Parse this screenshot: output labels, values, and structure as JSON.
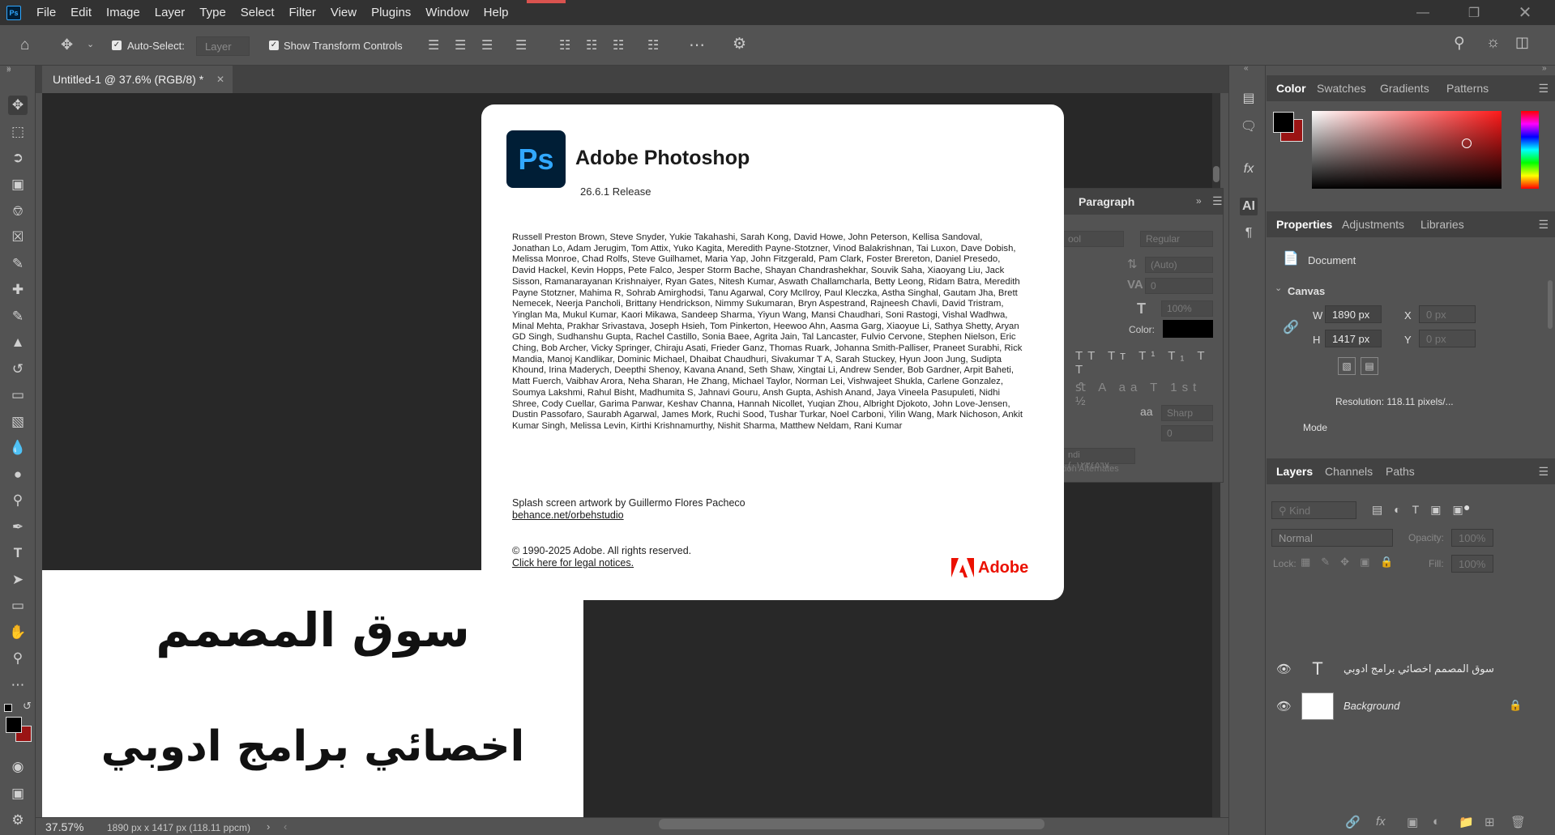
{
  "menubar": {
    "items": [
      "File",
      "Edit",
      "Image",
      "Layer",
      "Type",
      "Select",
      "Filter",
      "View",
      "Plugins",
      "Window",
      "Help"
    ]
  },
  "options": {
    "auto_select_label": "Auto-Select:",
    "auto_select_value": "Layer",
    "show_transform_label": "Show Transform Controls"
  },
  "document": {
    "tab_title": "Untitled-1 @ 37.6% (RGB/8) *",
    "arabic_line1": "سوق المصمم",
    "arabic_line2": "اخصائي برامج ادوبي"
  },
  "status": {
    "zoom": "37.57%",
    "info": "1890 px x 1417 px (118.11 ppcm)"
  },
  "paragraph_panel": {
    "tab": "Paragraph",
    "font_family": "ool",
    "font_style": "Regular",
    "leading": "(Auto)",
    "tracking": "0",
    "vertical_scale": "100%",
    "color_label": "Color:",
    "antialias": "Sharp",
    "language": "ndi (٠١٢٣٤٥٦٧...",
    "alternates": "tion Alternates",
    "aa_label": "aa"
  },
  "color_panel": {
    "tabs": [
      "Color",
      "Swatches",
      "Gradients",
      "Patterns"
    ],
    "foreground": "#000000",
    "background": "#9a1414"
  },
  "properties_panel": {
    "tabs": [
      "Properties",
      "Adjustments",
      "Libraries"
    ],
    "document_label": "Document",
    "canvas_label": "Canvas",
    "w_label": "W",
    "w_value": "1890 px",
    "h_label": "H",
    "h_value": "1417 px",
    "x_label": "X",
    "x_value": "0 px",
    "y_label": "Y",
    "y_value": "0 px",
    "resolution": "Resolution: 118.11 pixels/...",
    "mode_label": "Mode"
  },
  "layers_panel": {
    "tabs": [
      "Layers",
      "Channels",
      "Paths"
    ],
    "filter_placeholder": "Kind",
    "blend_mode": "Normal",
    "opacity_label": "Opacity:",
    "opacity_value": "100%",
    "lock_label": "Lock:",
    "fill_label": "Fill:",
    "fill_value": "100%",
    "layers": [
      {
        "name": "سوق المصمم  اخصائي برامج ادوبي",
        "type": "text"
      },
      {
        "name": "Background",
        "type": "background"
      }
    ]
  },
  "about": {
    "logo_text": "Ps",
    "app_name": "Adobe Photoshop",
    "version": "26.6.1 Release",
    "credits": "Russell Preston Brown, Steve Snyder, Yukie Takahashi, Sarah Kong, David Howe, John Peterson, Kellisa Sandoval, Jonathan Lo, Adam Jerugim, Tom Attix, Yuko Kagita, Meredith Payne-Stotzner, Vinod Balakrishnan, Tai Luxon, Dave Dobish, Melissa Monroe, Chad Rolfs, Steve Guilhamet, Maria Yap, John Fitzgerald, Pam Clark, Foster Brereton, Daniel Presedo, David Hackel, Kevin Hopps, Pete Falco, Jesper Storm Bache, Shayan Chandrashekhar, Souvik Saha, Xiaoyang Liu, Jack Sisson, Ramanarayanan Krishnaiyer, Ryan Gates, Nitesh Kumar, Aswath Challamcharla, Betty Leong, Ridam Batra, Meredith Payne Stotzner, Mahima R, Sohrab Amirghodsi, Tanu Agarwal, Cory McIlroy, Paul Kleczka, Astha Singhal, Gautam Jha, Brett Nemecek, Neerja Pancholi, Brittany Hendrickson, Nimmy Sukumaran, Bryn Aspestrand, Rajneesh Chavli, David Tristram, Yinglan Ma, Mukul Kumar, Kaori Mikawa, Sandeep Sharma, Yiyun Wang, Mansi Chaudhari, Soni Rastogi, Vishal Wadhwa, Minal Mehta, Prakhar Srivastava, Joseph Hsieh, Tom Pinkerton, Heewoo Ahn, Aasma Garg, Xiaoyue Li, Sathya Shetty, Aryan GD Singh, Sudhanshu Gupta, Rachel Castillo, Sonia Baee, Agrita Jain, Tal Lancaster, Fulvio Cervone, Stephen Nielson, Eric Ching, Bob Archer, Vicky Springer, Chiraju Asati, Frieder Ganz, Thomas Ruark, Johanna Smith-Palliser, Praneet Surabhi, Rick Mandia, Manoj Kandlikar, Dominic Michael, Dhaibat Chaudhuri, Sivakumar T A, Sarah Stuckey, Hyun Joon Jung, Sudipta Khound, Irina Maderych, Deepthi Shenoy, Kavana Anand, Seth Shaw, Xingtai Li, Andrew Sender, Bob Gardner, Arpit Baheti, Matt Fuerch, Vaibhav Arora, Neha Sharan, He Zhang, Michael Taylor, Norman Lei, Vishwajeet Shukla, Carlene Gonzalez, Soumya Lakshmi, Rahul Bisht, Madhumita S, Jahnavi Gouru, Ansh Gupta, Ashish Anand, Jaya Vineela Pasupuleti, Nidhi Shree, Cody Cuellar, Garima Panwar, Keshav Channa, Hannah Nicollet, Yuqian Zhou, Albright Djokoto, John Love-Jensen, Dustin Passofaro, Saurabh Agarwal, James Mork, Ruchi Sood, Tushar Turkar, Noel Carboni, Yilin Wang, Mark Nichoson, Ankit Kumar Singh, Melissa Levin, Kirthi Krishnamurthy, Nishit Sharma, Matthew Neldam, Rani Kumar",
    "artwork": "Splash screen artwork by Guillermo Flores Pacheco",
    "artwork_link": "behance.net/orbehstudio",
    "copyright": "© 1990-2025 Adobe. All rights reserved.",
    "legal_link": "Click here for legal notices.",
    "adobe_word": "Adobe",
    "brand_color": "#eb1000"
  }
}
